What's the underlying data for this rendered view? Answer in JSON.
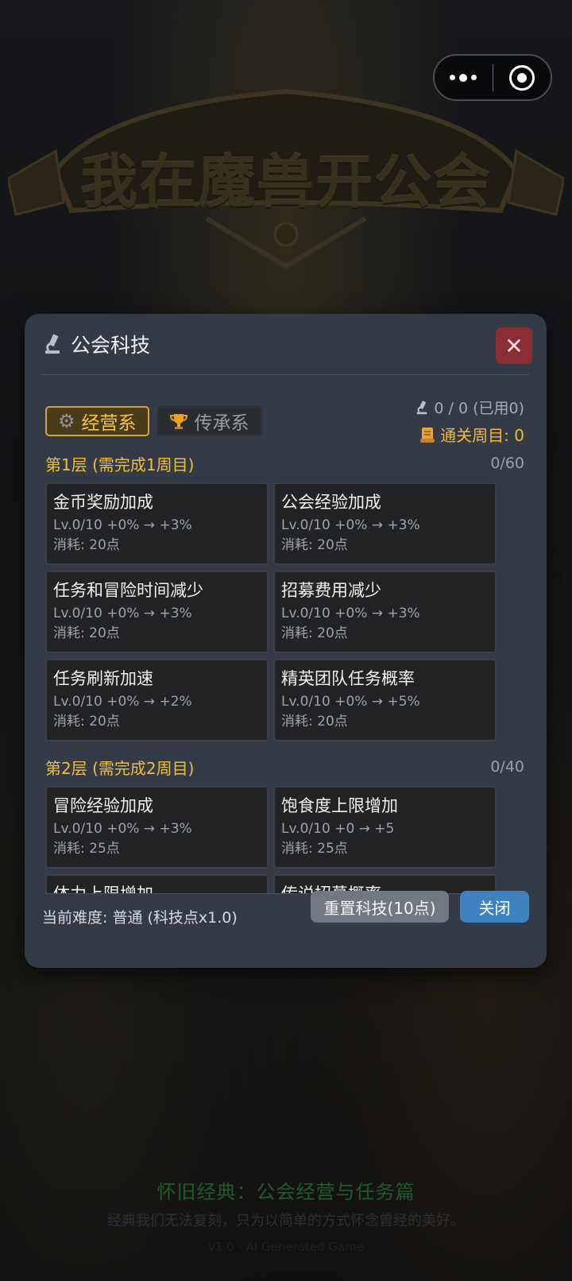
{
  "background": {
    "logo_text": "我在魔兽开公会",
    "footer_title": "怀旧经典：公会经营与任务篇",
    "footer_subtitle": "经典我们无法复刻，只为以简单的方式怀念曾经的美好。",
    "version": "v1.0 - AI Generated Game"
  },
  "capsule": {
    "more_icon": "more-dots-icon",
    "exit_icon": "target-icon"
  },
  "modal": {
    "title": "公会科技",
    "title_icon": "microscope-icon",
    "close_icon": "close-icon",
    "tabs": [
      {
        "label": "经营系",
        "icon": "gear-icon",
        "active": true
      },
      {
        "label": "传承系",
        "icon": "trophy-icon",
        "active": false
      }
    ],
    "stats": {
      "points": "0 / 0 (已用0)",
      "cycles": "通关周目: 0"
    },
    "tiers": [
      {
        "title": "第1层 (需完成1周目)",
        "count": "0/60",
        "items": [
          {
            "name": "金币奖励加成",
            "level": "Lv.0/10  +0% → +3%",
            "cost": "消耗: 20点"
          },
          {
            "name": "公会经验加成",
            "level": "Lv.0/10  +0% → +3%",
            "cost": "消耗: 20点"
          },
          {
            "name": "任务和冒险时间减少",
            "level": "Lv.0/10  +0% → +3%",
            "cost": "消耗: 20点"
          },
          {
            "name": "招募费用减少",
            "level": "Lv.0/10  +0% → +3%",
            "cost": "消耗: 20点"
          },
          {
            "name": "任务刷新加速",
            "level": "Lv.0/10  +0% → +2%",
            "cost": "消耗: 20点"
          },
          {
            "name": "精英团队任务概率",
            "level": "Lv.0/10  +0% → +5%",
            "cost": "消耗: 20点"
          }
        ]
      },
      {
        "title": "第2层 (需完成2周目)",
        "count": "0/40",
        "items": [
          {
            "name": "冒险经验加成",
            "level": "Lv.0/10  +0% → +3%",
            "cost": "消耗: 25点"
          },
          {
            "name": "饱食度上限增加",
            "level": "Lv.0/10  +0 → +5",
            "cost": "消耗: 25点"
          },
          {
            "name": "体力上限增加",
            "level": "",
            "cost": ""
          },
          {
            "name": "传说招募概率",
            "level": "",
            "cost": ""
          }
        ]
      }
    ],
    "difficulty": "当前难度: 普通 (科技点x1.0)",
    "reset_button": "重置科技(10点)",
    "close_button": "关闭"
  }
}
